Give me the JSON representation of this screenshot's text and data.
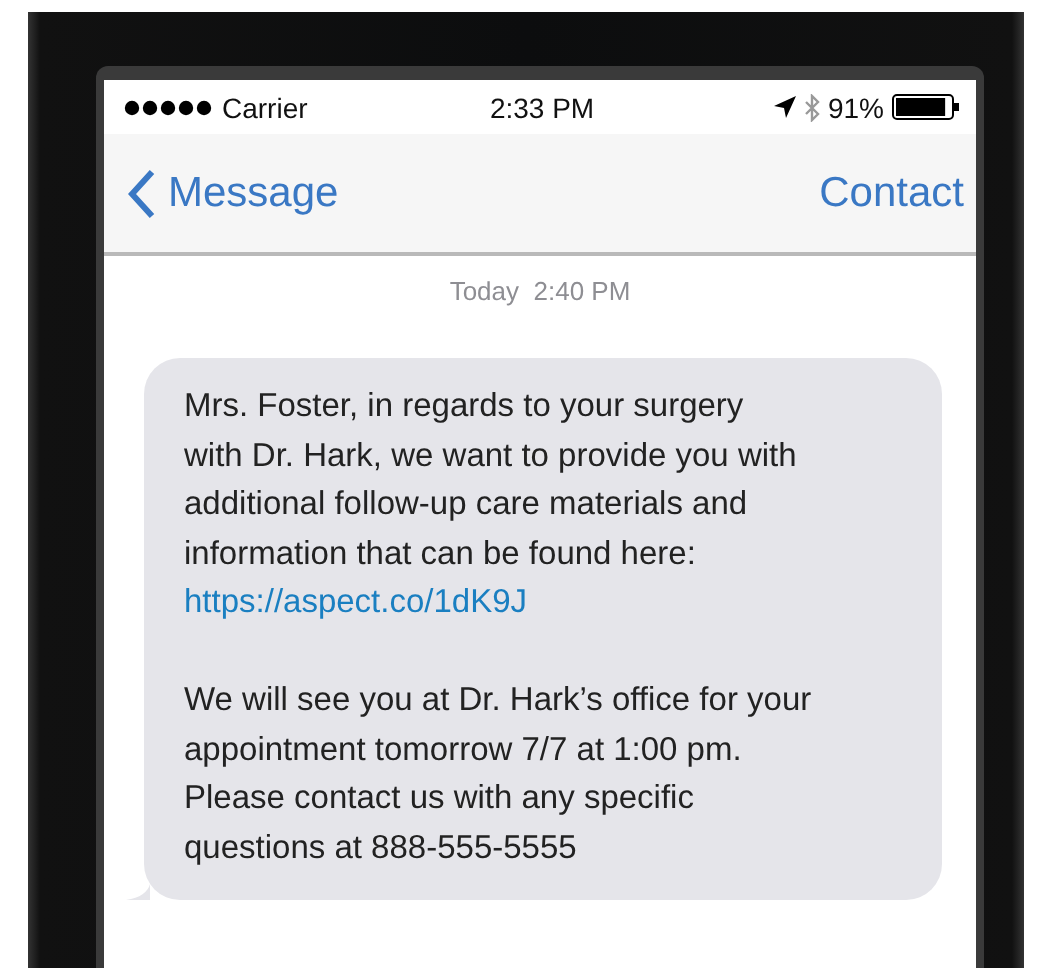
{
  "status_bar": {
    "carrier": "Carrier",
    "time": "2:33 PM",
    "battery": {
      "label": "91%",
      "level": 0.91
    }
  },
  "nav": {
    "back": "Message",
    "action": "Contact"
  },
  "timestamp": {
    "day": "Today",
    "time": "2:40 PM"
  },
  "message": {
    "paragraphs": [
      {
        "lines": [
          "Mrs. Foster, in regards to your surgery",
          "with Dr. Hark, we want to provide you with",
          "additional follow-up care materials and",
          "information that can be found here:"
        ],
        "link": "https://aspect.co/1dK9J"
      },
      {
        "lines": [
          "We will see you at Dr. Hark’s office for your",
          "appointment tomorrow 7/7 at 1:00 pm.",
          "Please contact us with any specific",
          "questions at 888-555-5555"
        ]
      }
    ]
  }
}
